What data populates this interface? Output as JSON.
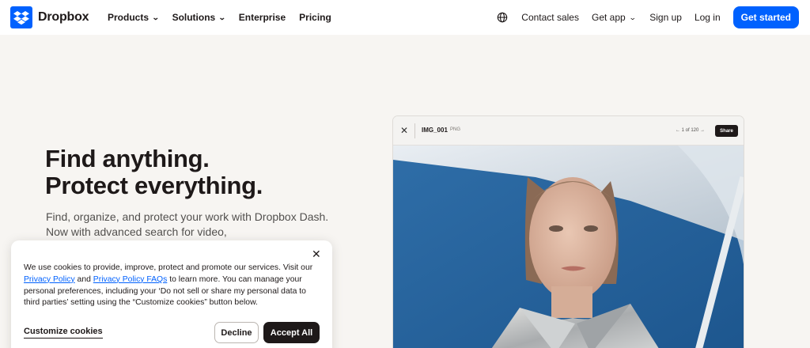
{
  "nav": {
    "logo_text": "Dropbox",
    "items": [
      {
        "label": "Products",
        "has_dropdown": true
      },
      {
        "label": "Solutions",
        "has_dropdown": true
      },
      {
        "label": "Enterprise",
        "has_dropdown": false
      },
      {
        "label": "Pricing",
        "has_dropdown": false
      }
    ],
    "globe_icon": "globe-icon",
    "contact_sales": "Contact sales",
    "get_app": "Get app",
    "sign_up": "Sign up",
    "log_in": "Log in",
    "get_started": "Get started"
  },
  "hero": {
    "headline_line1": "Find anything.",
    "headline_line2": "Protect everything.",
    "subtext": "Find, organize, and protect your work with Dropbox Dash. Now with advanced search for video,"
  },
  "preview": {
    "close_icon": "close-icon",
    "file_name": "IMG_001",
    "file_type": "PNG",
    "pager": "1 of 120",
    "share_label": "Share"
  },
  "cookie": {
    "text_intro": "We use cookies to provide, improve, protect and promote our services. Visit our ",
    "privacy_policy": "Privacy Policy",
    "and": " and ",
    "privacy_faqs": "Privacy Policy FAQs",
    "text_rest": " to learn more. You can manage your personal preferences, including your ‘Do not sell or share my personal data to third parties’ setting using the “Customize cookies” button below.",
    "customize": "Customize cookies",
    "decline": "Decline",
    "accept": "Accept All"
  },
  "colors": {
    "brand_blue": "#0061fe",
    "page_bg": "#f7f5f2",
    "dark": "#1e1919"
  }
}
